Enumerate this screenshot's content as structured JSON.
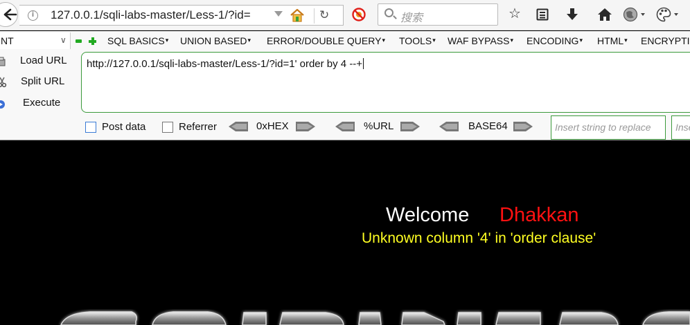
{
  "browser": {
    "url": "127.0.0.1/sqli-labs-master/Less-1/?id=",
    "search_placeholder": "搜索",
    "icons": [
      "back-arrow-icon",
      "info-icon",
      "url-dropdown-icon",
      "home-icon",
      "reload-icon",
      "noscript-icon",
      "search-icon",
      "bookmark-star-icon",
      "reading-list-icon",
      "download-icon",
      "home-icon",
      "globe-icon",
      "palette-icon"
    ]
  },
  "hackbar": {
    "selector_value": "NT",
    "menu": [
      "SQL BASICS",
      "UNION BASED",
      "ERROR/DOUBLE QUERY",
      "TOOLS",
      "WAF BYPASS",
      "ENCODING",
      "HTML",
      "ENCRYPTI"
    ],
    "actions": {
      "load_url": "Load URL",
      "split_url": "Split URL",
      "execute": "Execute"
    },
    "query": "http://127.0.0.1/sqli-labs-master/Less-1/?id=1' order by 4 --+",
    "post_data_label": "Post data",
    "referrer_label": "Referrer",
    "encoders": [
      "0xHEX",
      "%URL",
      "BASE64"
    ],
    "replace_placeholder": "Insert string to replace",
    "replace_with_placeholder": "Insert",
    "accent_color": "#3a9a3a"
  },
  "page": {
    "welcome": "Welcome",
    "name": "Dhakkan",
    "message": "Unknown column '4' in 'order clause'",
    "colors": {
      "background": "#000000",
      "welcome": "#ffffff",
      "name": "#ff1111",
      "message": "#ffff22"
    }
  }
}
